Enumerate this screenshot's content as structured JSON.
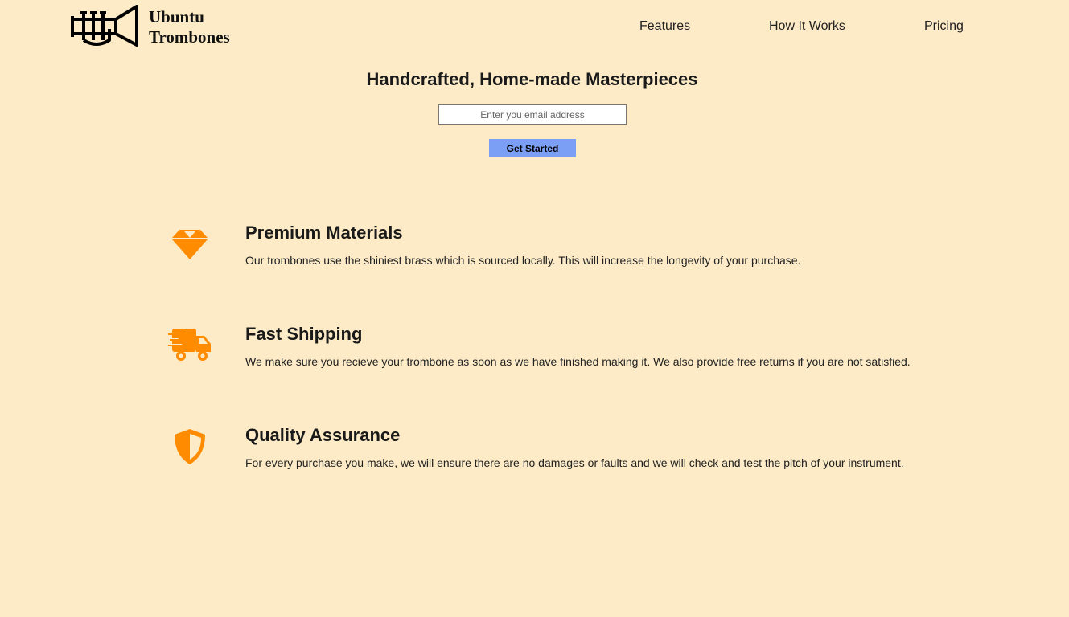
{
  "brand": {
    "name_line1": "Ubuntu",
    "name_line2": "Trombones",
    "logo_icon": "trombone-icon"
  },
  "nav": {
    "items": [
      {
        "label": "Features"
      },
      {
        "label": "How It Works"
      },
      {
        "label": "Pricing"
      }
    ]
  },
  "hero": {
    "title": "Handcrafted, Home-made Masterpieces",
    "email_placeholder": "Enter you email address",
    "email_value": "",
    "cta_label": "Get Started"
  },
  "features": [
    {
      "icon": "diamond-icon",
      "title": "Premium Materials",
      "text": "Our trombones use the shiniest brass which is sourced locally. This will increase the longevity of your purchase."
    },
    {
      "icon": "shipping-truck-icon",
      "title": "Fast Shipping",
      "text": "We make sure you recieve your trombone as soon as we have finished making it. We also provide free returns if you are not satisfied."
    },
    {
      "icon": "shield-icon",
      "title": "Quality Assurance",
      "text": "For every purchase you make, we will ensure there are no damages or faults and we will check and test the pitch of your instrument."
    }
  ],
  "colors": {
    "background": "#fcebc6",
    "accent": "#ff8c00",
    "button": "#7b9ff5"
  }
}
